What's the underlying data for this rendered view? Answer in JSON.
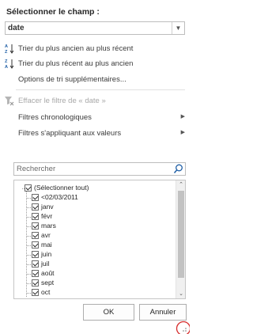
{
  "title": "Sélectionner le champ :",
  "field": {
    "value": "date"
  },
  "menu": {
    "sort_oldest": "Trier du plus ancien au plus récent",
    "sort_newest": "Trier du plus récent au plus ancien",
    "more_sort": "Options de tri supplémentaires...",
    "clear_filter": "Effacer le filtre de « date »",
    "chrono_filters": "Filtres chronologiques",
    "value_filters": "Filtres s'appliquant aux valeurs"
  },
  "search": {
    "placeholder": "Rechercher"
  },
  "list": {
    "select_all": "(Sélectionner tout)",
    "items": [
      "<02/03/2011",
      "janv",
      "févr",
      "mars",
      "avr",
      "mai",
      "juin",
      "juil",
      "août",
      "sept",
      "oct"
    ]
  },
  "buttons": {
    "ok": "OK",
    "cancel": "Annuler"
  },
  "colors": {
    "icon_blue": "#1f5fa6",
    "highlight_red": "#d62d2d"
  }
}
